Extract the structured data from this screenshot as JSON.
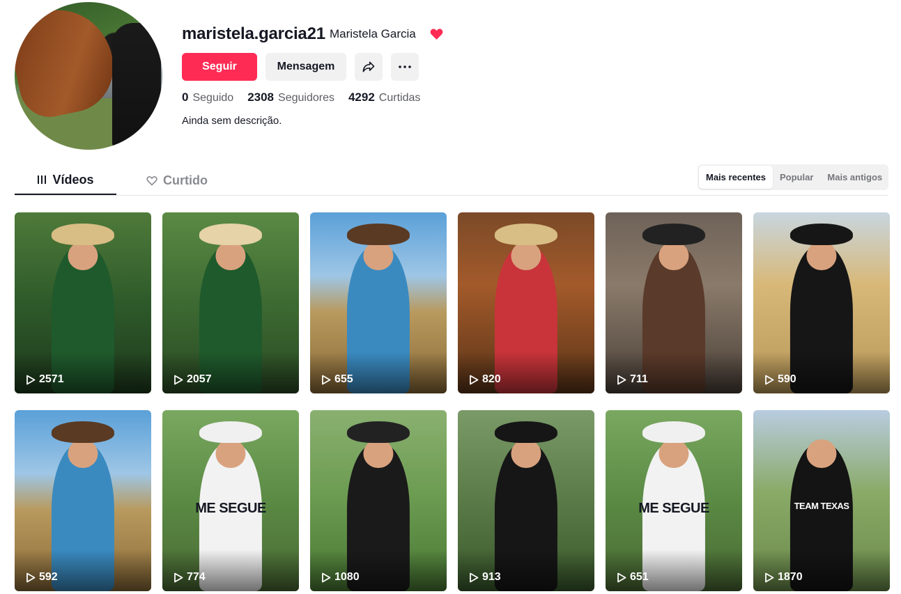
{
  "profile": {
    "username": "maristela.garcia21",
    "nickname": "Maristela Garcia",
    "bio": "Ainda sem descrição."
  },
  "actions": {
    "follow_label": "Seguir",
    "message_label": "Mensagem"
  },
  "stats": {
    "following": "0",
    "following_label": "Seguido",
    "followers": "2308",
    "followers_label": "Seguidores",
    "likes": "4292",
    "likes_label": "Curtidas"
  },
  "tabs": [
    {
      "label": "Vídeos",
      "active": true
    },
    {
      "label": "Curtido",
      "active": false
    }
  ],
  "sort": [
    "Mais recentes",
    "Popular",
    "Mais antigos"
  ],
  "colors": {
    "accent": "#fe2c55",
    "heart": "#fe2c55"
  },
  "videos": [
    {
      "views": "2571",
      "shirt": ""
    },
    {
      "views": "2057",
      "shirt": ""
    },
    {
      "views": "655",
      "shirt": ""
    },
    {
      "views": "820",
      "shirt": ""
    },
    {
      "views": "711",
      "shirt": ""
    },
    {
      "views": "590",
      "shirt": ""
    },
    {
      "views": "592",
      "shirt": ""
    },
    {
      "views": "774",
      "shirt": "ME SEGUE"
    },
    {
      "views": "1080",
      "shirt": ""
    },
    {
      "views": "913",
      "shirt": ""
    },
    {
      "views": "651",
      "shirt": "ME SEGUE"
    },
    {
      "views": "1870",
      "shirt": "TEAM TEXAS"
    }
  ]
}
